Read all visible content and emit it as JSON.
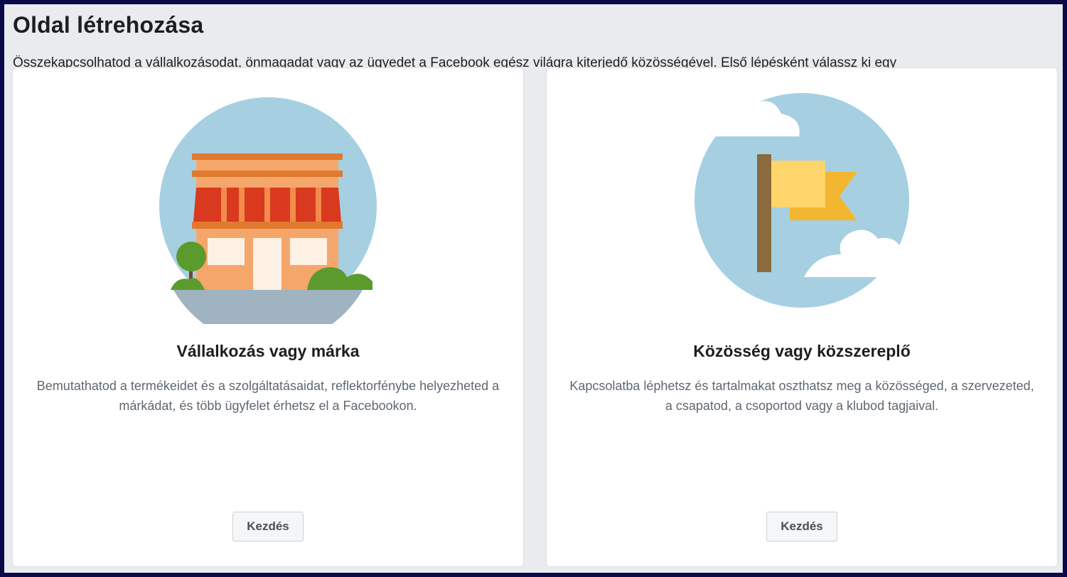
{
  "page": {
    "title": "Oldal létrehozása",
    "subtitle": "Összekapcsolhatod a vállalkozásodat, önmagadat vagy az ügyedet a Facebook egész világra kiterjedő közösségével. Első lépésként válassz ki egy"
  },
  "cards": [
    {
      "icon": "storefront-icon",
      "title": "Vállalkozás vagy márka",
      "description": "Bemutathatod a termékeidet és a szolgáltatásaidat, reflektorfénybe helyezheted a márkádat, és több ügyfelet érhetsz el a Facebookon.",
      "button_label": "Kezdés"
    },
    {
      "icon": "flag-icon",
      "title": "Közösség vagy közszereplő",
      "description": "Kapcsolatba léphetsz és tartalmakat oszthatsz meg a közösséged, a szervezeted, a csapatod, a csoportod vagy a klubod tagjaival.",
      "button_label": "Kezdés"
    }
  ],
  "colors": {
    "outer_border": "#0a0a4a",
    "background": "#e9ebee",
    "card_background": "#ffffff",
    "illustration_circle": "#a6cfe2",
    "awning_red": "#d8391f",
    "shop_orange": "#f5a66b",
    "tree_green": "#5b9b2e",
    "flag_yellow": "#ffd46b",
    "flag_dark_yellow": "#f2b630",
    "pole_brown": "#8b6a3e"
  }
}
